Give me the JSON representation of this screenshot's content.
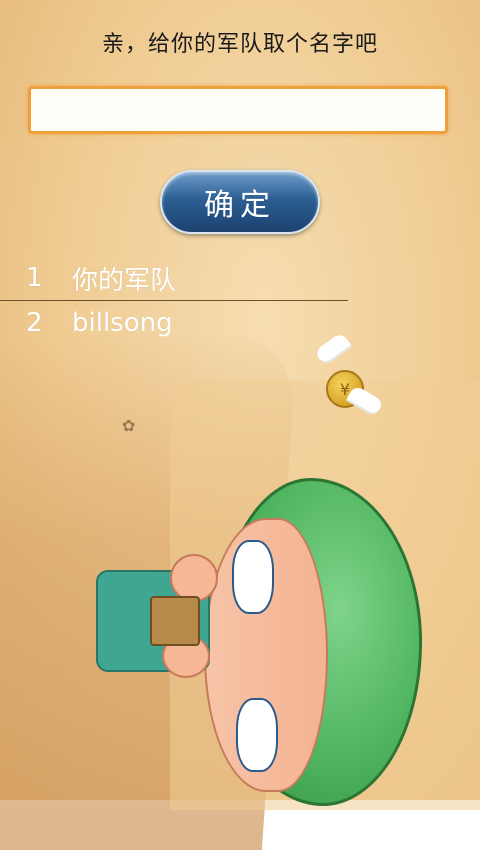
{
  "header": {
    "title": "亲，给你的军队取个名字吧"
  },
  "name_input": {
    "value": "",
    "placeholder": ""
  },
  "confirm_button": {
    "label": "确定"
  },
  "name_list": {
    "items": [
      {
        "index": "1",
        "name": "你的军队"
      },
      {
        "index": "2",
        "name": "billsong"
      }
    ]
  },
  "colors": {
    "input_border": "#f0a03a",
    "button_fill": "#2d5f93",
    "list_text": "#ffffff",
    "background": "#efcb92"
  },
  "icons": {
    "coin": "winged-coin-icon",
    "soldier": "soldier-illustration"
  }
}
